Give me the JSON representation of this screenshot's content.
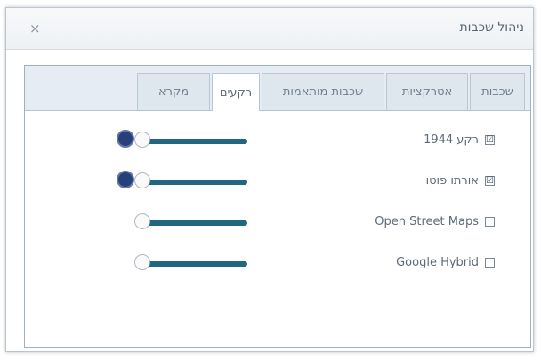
{
  "window": {
    "title": "ניהול שכבות",
    "close_icon": "×"
  },
  "tabs": [
    {
      "label": "שכבות"
    },
    {
      "label": "אטרקציות"
    },
    {
      "label": "שכבות מותאמות"
    },
    {
      "label": "רקעים"
    },
    {
      "label": "מקרא"
    }
  ],
  "active_tab_index": 3,
  "layers": [
    {
      "label": "רקע 1944",
      "checked": true,
      "checkbox_symbol": "☑",
      "opacity": 1.0,
      "info_icon": true
    },
    {
      "label": "אורתו פוטו",
      "checked": true,
      "checkbox_symbol": "☑",
      "opacity": 1.0,
      "info_icon": true
    },
    {
      "label": "Open Street Maps",
      "checked": false,
      "checkbox_symbol": "",
      "opacity": 1.0,
      "info_icon": false
    },
    {
      "label": "Google Hybrid",
      "checked": false,
      "checkbox_symbol": "",
      "opacity": 1.0,
      "info_icon": false
    }
  ],
  "colors": {
    "slider_track": "#20677f",
    "info_dot": "#27407a",
    "tab_bg": "#dfe7ee",
    "active_tab_bg": "#ffffff"
  }
}
